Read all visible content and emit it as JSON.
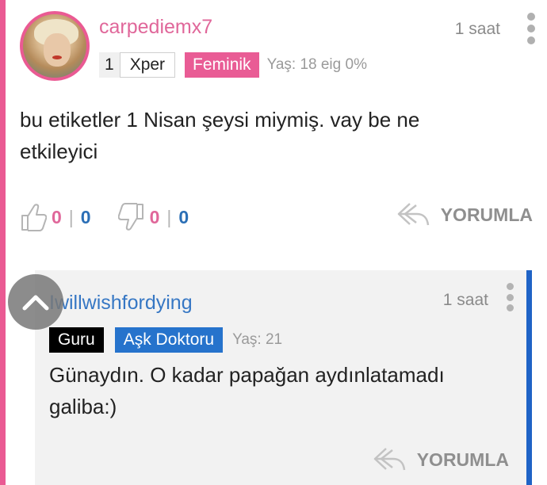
{
  "post": {
    "username": "carpediemx7",
    "time": "1 saat",
    "level_number": "1",
    "level_name": "Xper",
    "badge": "Feminik",
    "meta": "Yaş: 18 eig 0%",
    "body": "bu etiketler 1 Nisan şeysi miymiş. vay be ne etkileyici",
    "likes_pink": "0",
    "likes_blue": "0",
    "dislikes_pink": "0",
    "dislikes_blue": "0",
    "separator": "|",
    "reply_label": "YORUMLA"
  },
  "reply": {
    "username": "Iwillwishfordying",
    "time": "1 saat",
    "badge_primary": "Guru",
    "badge_secondary": "Aşk Doktoru",
    "meta": "Yaş: 21",
    "body": "Günaydın. O kadar papağan aydınlatamadı galiba:)",
    "reply_label": "YORUMLA"
  },
  "colors": {
    "pink_accent": "#ea5a93",
    "blue_accent": "#1f63c6",
    "count_pink": "#e0679a",
    "count_blue": "#2b6fb6"
  },
  "icons": [
    "thumbs-up-icon",
    "thumbs-down-icon",
    "reply-arrow-icon",
    "kebab-menu-icon",
    "chevron-up-icon"
  ]
}
